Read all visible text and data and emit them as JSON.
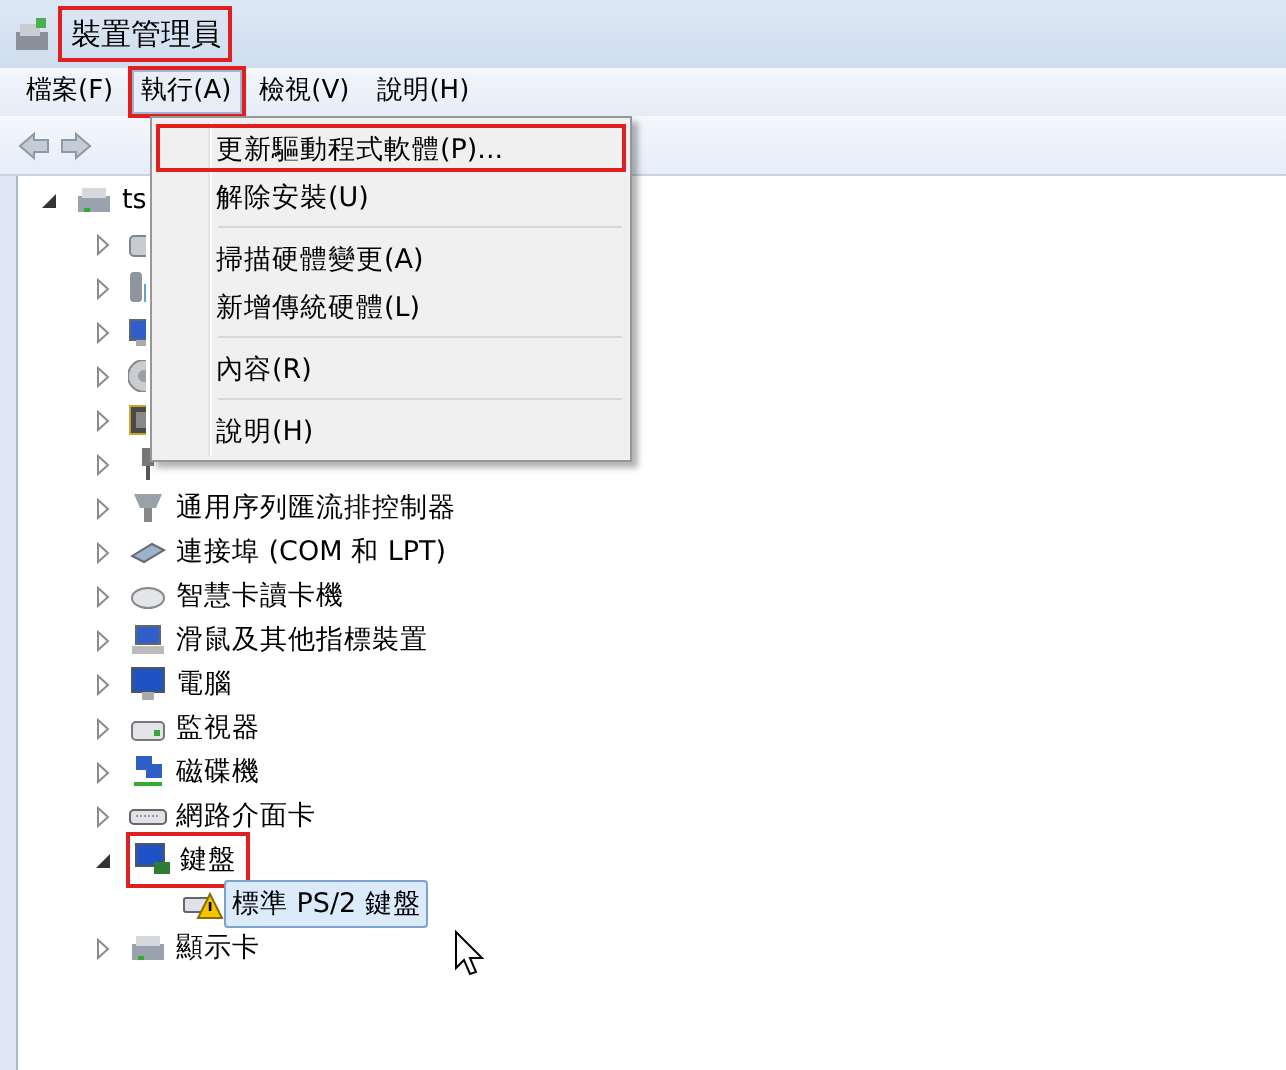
{
  "window": {
    "title": "裝置管理員",
    "highlighted": true
  },
  "menu_bar": [
    {
      "label": "檔案(F)",
      "selected": false,
      "highlighted": false
    },
    {
      "label": "執行(A)",
      "selected": true,
      "highlighted": true
    },
    {
      "label": "檢視(V)",
      "selected": false,
      "highlighted": false
    },
    {
      "label": "說明(H)",
      "selected": false,
      "highlighted": false
    }
  ],
  "dropdown": [
    {
      "kind": "item",
      "label": "更新驅動程式軟體(P)...",
      "highlighted": true
    },
    {
      "kind": "item",
      "label": "解除安裝(U)",
      "highlighted": false
    },
    {
      "kind": "separator"
    },
    {
      "kind": "item",
      "label": "掃描硬體變更(A)",
      "highlighted": false
    },
    {
      "kind": "item",
      "label": "新增傳統硬體(L)",
      "highlighted": false
    },
    {
      "kind": "separator"
    },
    {
      "kind": "item",
      "label": "內容(R)",
      "highlighted": false
    },
    {
      "kind": "separator"
    },
    {
      "kind": "item",
      "label": "說明(H)",
      "highlighted": false
    }
  ],
  "tree": [
    {
      "label": "ts",
      "expanded": true,
      "selected": false,
      "highlighted": false,
      "children": [
        {
          "expanded": false
        },
        {
          "expanded": false
        },
        {
          "expanded": false
        },
        {
          "expanded": false
        },
        {
          "expanded": false
        },
        {
          "expanded": false
        },
        {
          "label": "通用序列匯流排控制器",
          "expanded": false
        },
        {
          "label": "連接埠 (COM 和 LPT)",
          "expanded": false
        },
        {
          "label": "智慧卡讀卡機",
          "expanded": false
        },
        {
          "label": "滑鼠及其他指標裝置",
          "expanded": false
        },
        {
          "label": "電腦",
          "expanded": false
        },
        {
          "label": "監視器",
          "expanded": false
        },
        {
          "label": "磁碟機",
          "expanded": false
        },
        {
          "label": "網路介面卡",
          "expanded": false
        },
        {
          "label": "鍵盤",
          "expanded": true,
          "highlighted": true,
          "children": [
            {
              "label": "標準 PS/2 鍵盤",
              "selected": true,
              "warning": true
            }
          ]
        },
        {
          "label": "顯示卡",
          "expanded": false
        }
      ]
    }
  ]
}
